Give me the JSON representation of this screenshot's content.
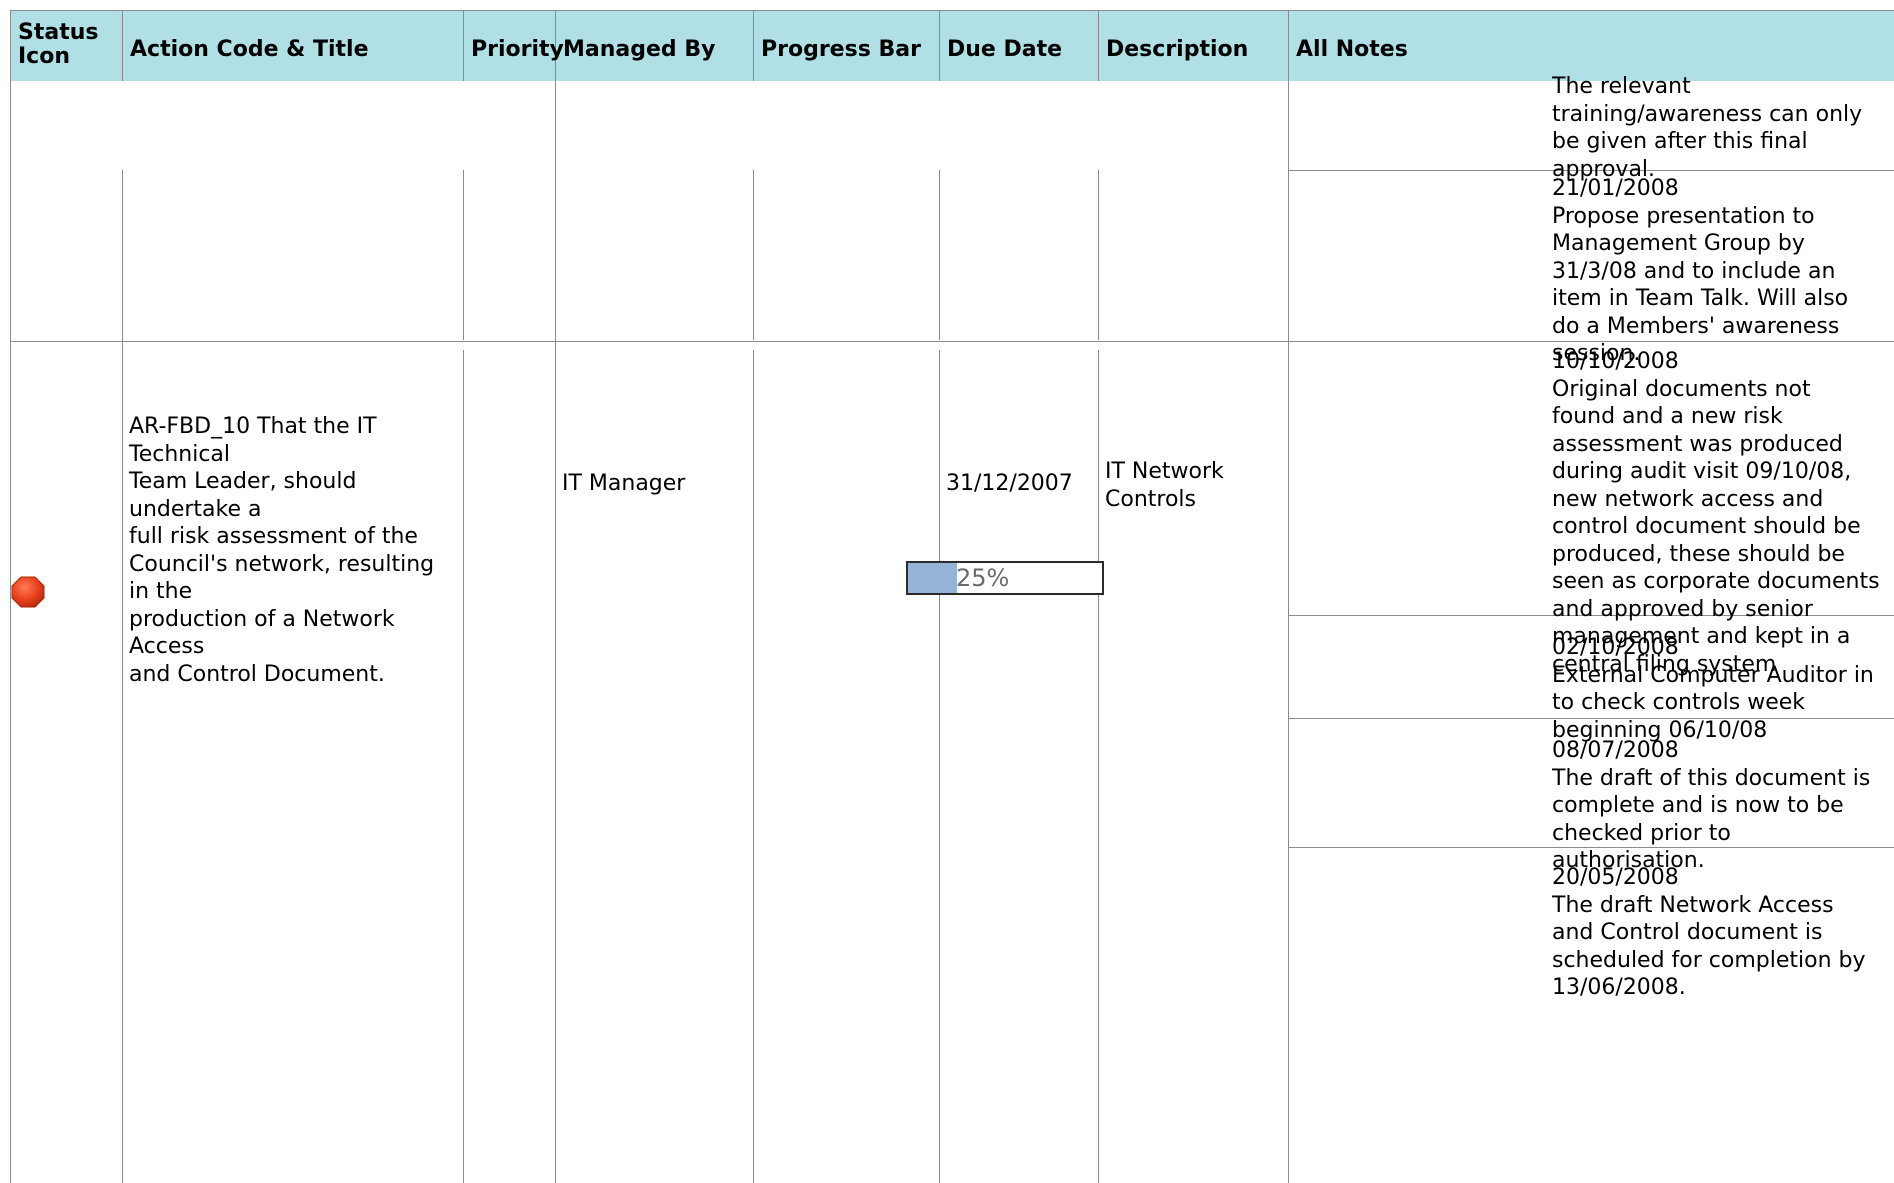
{
  "colors": {
    "header_bg": "#b0e0e6",
    "grid": "#8c8c8c",
    "status_red": "#e8401c",
    "progress_fill": "#95b3d7"
  },
  "headers": {
    "status_icon": "Status\nIcon",
    "action_code_title": "Action Code & Title",
    "priority": "Priority",
    "managed_by": "Managed By",
    "progress_bar": "Progress Bar",
    "due_date": "Due Date",
    "description": "Description",
    "all_notes": "All Notes"
  },
  "prev_row": {
    "notes": [
      {
        "text": "The relevant\ntraining/awareness can only\nbe given after this final\napproval."
      },
      {
        "text": "21/01/2008\nPropose presentation to\nManagement Group by\n31/3/08 and to include an\nitem in Team Talk. Will also\ndo a Members' awareness\nsession."
      }
    ]
  },
  "action_row": {
    "status_icon": "red-octagon-status-icon",
    "action_title": "AR-FBD_10 That the IT Technical\nTeam Leader, should undertake a\nfull risk assessment of the\nCouncil's network, resulting in the\nproduction of a Network Access\nand Control Document.",
    "priority": "",
    "managed_by": "IT Manager",
    "progress_percent": 25,
    "progress_label": "25%",
    "due_date": "31/12/2007",
    "description": "IT Network\nControls",
    "notes": [
      {
        "text": "10/10/2008\nOriginal documents not\nfound and a new risk\nassessment was produced\nduring audit visit 09/10/08,\nnew network access and\ncontrol document should be\nproduced, these should be\nseen as corporate documents\nand approved by senior\nmanagement and kept in a\ncentral filing system"
      },
      {
        "text": "02/10/2008\nExternal Computer Auditor in\nto check controls week\nbeginning 06/10/08"
      },
      {
        "text": "08/07/2008\nThe draft of this document is\ncomplete and is now to be\nchecked prior to\nauthorisation."
      },
      {
        "text": "20/05/2008\nThe draft Network Access\nand Control document is\nscheduled for completion by\n13/06/2008."
      }
    ]
  }
}
